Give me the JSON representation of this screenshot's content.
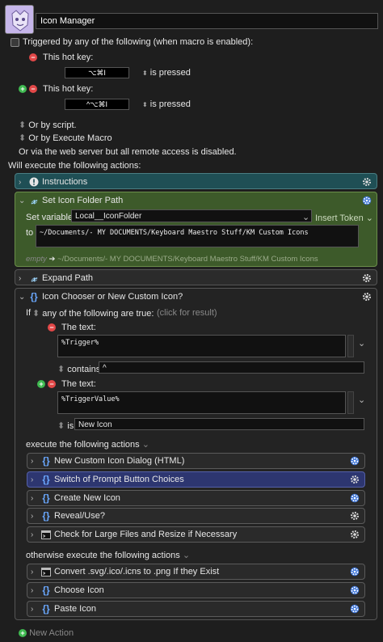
{
  "macro": {
    "name": "Icon Manager"
  },
  "triggers": {
    "triggered_by_label": "Triggered by any of the following (when macro is enabled):",
    "hotkey_label": "This hot key:",
    "hotkey1": "⌥⌘I",
    "hotkey2": "^⌥⌘I",
    "is_pressed": "is pressed",
    "or_by_script": "Or by script.",
    "or_by_execute": "Or by Execute Macro",
    "web_server": "Or via the web server but all remote access is disabled.",
    "will_execute": "Will execute the following actions:"
  },
  "actions": {
    "instructions": "Instructions",
    "set_var_title": "Set Icon Folder Path",
    "set_variable_label": "Set variable",
    "variable_name": "Local__IconFolder",
    "insert_token": "Insert Token",
    "to_label": "to",
    "to_value": "~/Documents/- MY DOCUMENTS/Keyboard Maestro Stuff/KM Custom Icons",
    "preview_empty": "empty",
    "preview_value": "~/Documents/- MY DOCUMENTS/Keyboard Maestro Stuff/KM Custom Icons",
    "expand_path": "Expand Path",
    "if_title": "Icon Chooser or New Custom Icon?",
    "if_label": "If",
    "any_label": "any of the following are true:",
    "click_result": "(click for result)",
    "the_text_label": "The text:",
    "cond1_text": "%Trigger%",
    "cond1_op": "contains",
    "cond1_value": "^",
    "cond2_text": "%TriggerValue%",
    "cond2_op": "is",
    "cond2_value": "New Icon",
    "execute_label": "execute the following actions",
    "then_actions": [
      "New Custom Icon Dialog (HTML)",
      "Switch of Prompt Button Choices",
      "Create New Icon",
      "Reveal/Use?",
      "Check for Large Files and Resize if Necessary"
    ],
    "otherwise_label": "otherwise execute the following actions",
    "else_actions": [
      "Convert .svg/.ico/.icns to .png If they Exist",
      "Choose Icon",
      "Paste Icon"
    ],
    "new_action": "New Action"
  },
  "colors": {
    "instructions_bg": "#1f4f55",
    "set_var_bg": "#3d5a2a",
    "selected_action_bg": "#2d3670"
  }
}
